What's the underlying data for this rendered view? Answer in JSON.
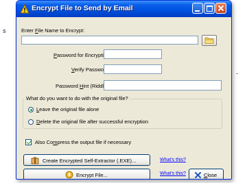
{
  "side": {
    "left_char": "s",
    "right_char": "-"
  },
  "window": {
    "title": "Encrypt File to Send by Email"
  },
  "file_name": {
    "label_before": "Enter ",
    "label_accel": "F",
    "label_after": "ile Name to Encrypt:",
    "value": ""
  },
  "password": {
    "label_accel": "P",
    "label_after": "assword for Encryption:",
    "value": ""
  },
  "verify": {
    "label_accel": "V",
    "label_after": "erify Password:",
    "value": ""
  },
  "hint": {
    "label_before": "Password ",
    "label_accel": "H",
    "label_after": "int (Riddle):",
    "value": ""
  },
  "original": {
    "question": "What do you want to do with the original file?",
    "options": [
      {
        "accel": "L",
        "rest": "eave the original file alone",
        "selected": true
      },
      {
        "accel": "D",
        "rest": "elete the original file after successful encryption",
        "selected": false
      }
    ]
  },
  "compress": {
    "before": "Also Co",
    "accel": "m",
    "after": "press the output file if necessary",
    "checked": true
  },
  "buttons": {
    "self_extractor": "Create Encrypted Self-Extractor (.EXE)...",
    "encrypt_file": "Encrypt File...",
    "close_accel": "C",
    "close_rest": "lose"
  },
  "links": {
    "whats_this_1": "What's this?",
    "whats_this_2": "What's this?"
  },
  "colors": {
    "title_bar": "#0054e3",
    "dialog_bg": "#ece9d8",
    "link": "#0000ff",
    "check_mark": "#21a121"
  }
}
